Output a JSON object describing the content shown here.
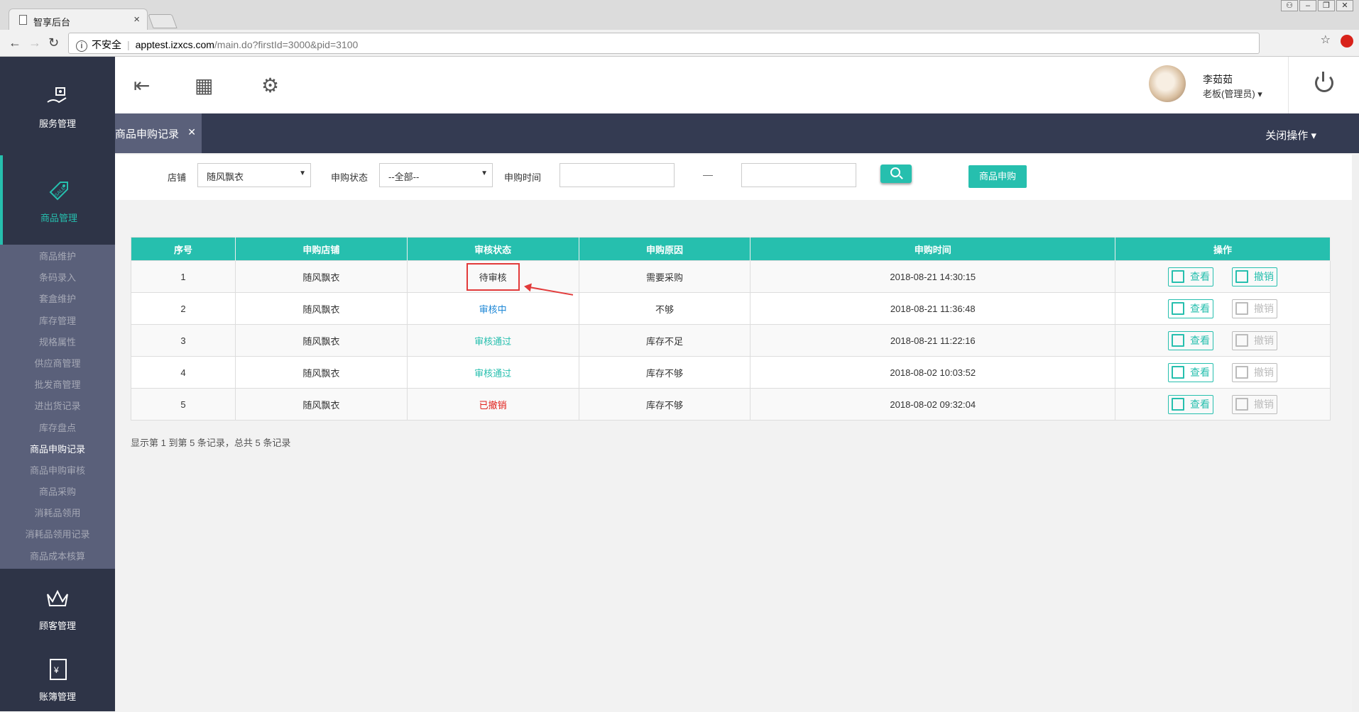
{
  "browser": {
    "tab_title": "智享后台",
    "tab_close": "×",
    "security_label": "不安全",
    "url_host": "apptest.izxcs.com",
    "url_path": "/main.do?firstId=3000&pid=3100"
  },
  "sidebar": {
    "service": "服务管理",
    "goods": "商品管理",
    "sub_items": [
      "商品维护",
      "条码录入",
      "套盒维护",
      "库存管理",
      "规格属性",
      "供应商管理",
      "批发商管理",
      "进出货记录",
      "库存盘点",
      "商品申购记录",
      "商品申购审核",
      "商品采购",
      "消耗品领用",
      "消耗品领用记录",
      "商品成本核算"
    ],
    "current_sub": "商品申购记录",
    "customer": "顾客管理",
    "account": "账簿管理"
  },
  "header": {
    "user_name": "李茹茹",
    "user_role": "老板(管理员)"
  },
  "tabbar": {
    "page_tab": "商品申购记录",
    "close_ops": "关闭操作"
  },
  "filter": {
    "store_label": "店铺",
    "store_value": "随风飘衣",
    "status_label": "申购状态",
    "status_value": "--全部--",
    "time_label": "申购时间",
    "dash": "—",
    "apply_button": "商品申购"
  },
  "table": {
    "headers": [
      "序号",
      "申购店铺",
      "审核状态",
      "申购原因",
      "申购时间",
      "操作"
    ],
    "view_label": "查看",
    "revoke_label": "撤销",
    "rows": [
      {
        "no": "1",
        "store": "随风飘衣",
        "status": "待审核",
        "reason": "需要采购",
        "time": "2018-08-21 14:30:15"
      },
      {
        "no": "2",
        "store": "随风飘衣",
        "status": "审核中",
        "reason": "不够",
        "time": "2018-08-21 11:36:48"
      },
      {
        "no": "3",
        "store": "随风飘衣",
        "status": "审核通过",
        "reason": "库存不足",
        "time": "2018-08-21 11:22:16"
      },
      {
        "no": "4",
        "store": "随风飘衣",
        "status": "审核通过",
        "reason": "库存不够",
        "time": "2018-08-02 10:03:52"
      },
      {
        "no": "5",
        "store": "随风飘衣",
        "status": "已撤销",
        "reason": "库存不够",
        "time": "2018-08-02 09:32:04"
      }
    ]
  },
  "summary": "显示第 1 到第 5 条记录，总共 5 条记录",
  "colors": {
    "accent": "#26bfae",
    "sidebar": "#2e3447",
    "tabbar": "#343b52",
    "highlight": "#e23a3a"
  }
}
